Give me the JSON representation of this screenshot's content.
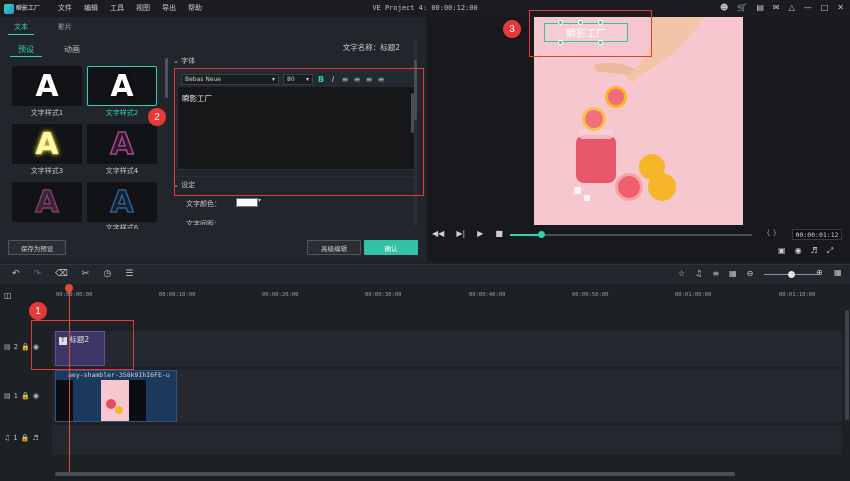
{
  "titlebar": {
    "logo_text": "瞬影工厂",
    "menu": [
      "文件",
      "编辑",
      "工具",
      "视图",
      "导出",
      "帮助"
    ],
    "project_title": "VE Project 4: 00:00:12:00",
    "icons": [
      "user-icon",
      "cart-icon",
      "save-icon",
      "mail-icon",
      "mic-icon",
      "minimize-icon",
      "maximize-icon",
      "close-icon"
    ]
  },
  "left": {
    "tabs": [
      "文本",
      "影片"
    ],
    "subtabs": [
      "预设",
      "动画"
    ],
    "text_name": "文字名称：标题2",
    "styles": [
      {
        "label": "文字样式1",
        "color": "#ffffff"
      },
      {
        "label": "文字样式2",
        "color": "#ffffff"
      },
      {
        "label": "文字样式3",
        "color": "#fff7b0"
      },
      {
        "label": "文字样式4",
        "color": "#6b3c7a"
      },
      {
        "label": "",
        "color": "#6b3c66"
      },
      {
        "label": "文字样式6",
        "color": "#243a5c"
      }
    ],
    "font_section": "字体",
    "font_name": "Bebas Neue",
    "font_size": "80",
    "editor_text": "瞬影工厂",
    "settings_section": "设定",
    "text_color_label": "文字颜色：",
    "text_spacing_label": "文字间距：",
    "save_preset": "保存为预设",
    "advanced_edit": "高级编辑",
    "confirm": "确认"
  },
  "annotations": [
    "1",
    "2",
    "3"
  ],
  "preview": {
    "overlay_text": "瞬影工厂",
    "timecode": "00:00:01:12"
  },
  "timeline": {
    "ruler": [
      "00:00:00:00",
      "00:00:10:00",
      "00:00:20:00",
      "00:00:30:00",
      "00:00:40:00",
      "00:00:50:00",
      "00:01:00:00",
      "00:01:10:00"
    ],
    "tracks": [
      {
        "num": "2"
      },
      {
        "num": "1"
      },
      {
        "num": "1"
      }
    ],
    "title_clip": "标题2",
    "video_clip": "aey-shambler-358k9IhI6FE-u"
  },
  "colors": {
    "accent": "#33d1b6",
    "annotation": "#e53a3a",
    "canvas": "#f6c7cf"
  }
}
